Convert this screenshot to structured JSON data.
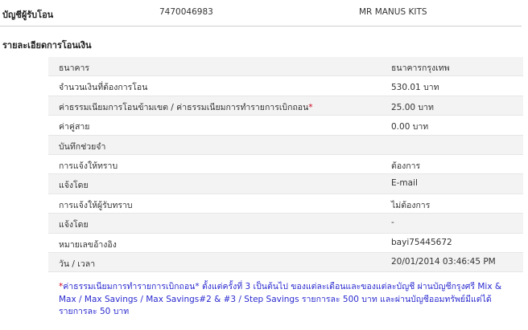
{
  "recipient": {
    "label": "บัญชีผู้รับโอน",
    "account_number": "7470046983",
    "name": "MR MANUS KITS"
  },
  "section_title": "รายละเอียดการโอนเงิน",
  "rows": [
    {
      "label": "ธนาคาร",
      "value": "ธนาคารกรุงเทพ"
    },
    {
      "label": "จำนวนเงินที่ต้องการโอน",
      "value": "530.01 บาท"
    },
    {
      "label": "ค่าธรรมเนียมการโอนข้ามเขต / ค่าธรรมเนียมการทำรายการเบิกถอน",
      "label_mark": "*",
      "value": "25.00 บาท"
    },
    {
      "label": "ค่าคู่สาย",
      "value": "0.00 บาท"
    },
    {
      "label": "บันทึกช่วยจำ",
      "value": ""
    },
    {
      "label": "การแจ้งให้ทราบ",
      "value": "ต้องการ"
    },
    {
      "label": "แจ้งโดย",
      "value": "E-mail"
    },
    {
      "label": "การแจ้งให้ผู้รับทราบ",
      "value": "ไม่ต้องการ"
    },
    {
      "label": "แจ้งโดย",
      "value": "-"
    },
    {
      "label": "หมายเลขอ้างอิง",
      "value": "bayi75445672"
    },
    {
      "label": "วัน / เวลา",
      "value": "20/01/2014 03:46:45 PM"
    }
  ],
  "footnote": {
    "mark": "*",
    "text": "ค่าธรรมเนียมการทำรายการเบิกถอน* ตั้งแต่ครั้งที่ 3 เป็นต้นไป ของแต่ละเดือนและของแต่ละบัญชี ผ่านบัญชีกรุงศรี Mix & Max / Max Savings / Max Savings#2 & #3 / Step Savings รายการละ 500 บาท และผ่านบัญชีออมทรัพย์มีแต่ได้ รายการละ 50 บาท"
  },
  "colors": {
    "footnote": "#2a2ad0",
    "asterisk": "#d0021b",
    "row_alt_bg": "#f3f3f3"
  }
}
